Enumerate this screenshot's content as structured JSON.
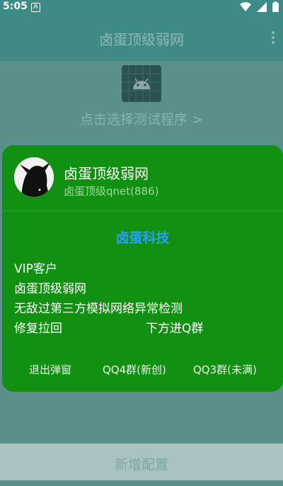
{
  "status_bar": {
    "time": "5:05",
    "notification_letter": "A"
  },
  "app_bar": {
    "title": "卤蛋顶级弱网"
  },
  "background": {
    "select_program_link": "点击选择测试程序 >",
    "add_config_button": "新增配置"
  },
  "dialog": {
    "user_name": "卤蛋顶级弱网",
    "user_sub": "卤蛋顶级qnet(886)",
    "brand": "卤蛋科技",
    "lines": [
      "VIP客户",
      "卤蛋顶级弱网",
      "无敌过第三方模拟网络异常检测",
      "修复拉回"
    ],
    "line_right": "下方进Q群",
    "buttons": {
      "exit": "退出弹窗",
      "qq4": "QQ4群(新创)",
      "qq3": "QQ3群(未满)"
    }
  },
  "colors": {
    "dialog_green": "#129012",
    "brand_blue": "#27a0ff",
    "scrim_teal": "#5b8f8a"
  },
  "icons": [
    "wifi-icon",
    "signal-icon",
    "battery-icon",
    "android-icon",
    "more-vert-icon"
  ]
}
